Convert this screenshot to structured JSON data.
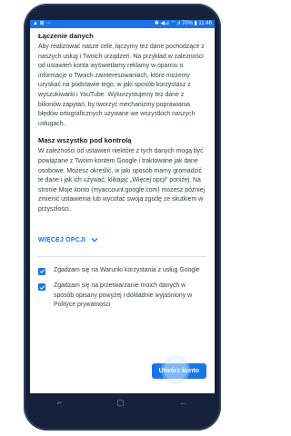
{
  "status_bar": {
    "left_icons": "▲ ⊠ ⋯",
    "right_text": "✱ ◀⊿ ⌔.ıl 70% ▮ 11:46"
  },
  "sections": [
    {
      "title": "Łączenie danych",
      "body": "Aby realizować nasze cele, łączymy też dane pochodzące z naszych usług i Twoich urządzeń. Na przykład w zależności od ustawień konta wyświetlamy reklamy w oparciu o informacje o Twoich zainteresowaniach, które możemy uzyskać na podstawie tego, w jaki sposób korzystasz z wyszukiwarki i YouTube. Wykorzystujemy też dane z bilionów zapytań, by tworzyć mechanizmy poprawiania błędów ortograficznych używane we wszystkich naszych usługach."
    },
    {
      "title": "Masz wszystko pod kontrolą",
      "body": "W zależności od ustawień niektóre z tych danych mogą być powiązane z Twoim kontem Google i traktowane jak dane osobowe. Możesz określić, w jaki sposób mamy gromadzić te dane i jak ich używać, klikając „Więcej opcji” poniżej. Na stronie Moje konto (myaccount.google.com) możesz później zmienić ustawienia lub wycofać swoją zgodę ze skutkiem w przyszłości."
    }
  ],
  "more_options": {
    "label": "WIĘCEJ OPCJI",
    "icon": "chevron-down-icon"
  },
  "checkboxes": [
    {
      "label": "Zgadzam się na Warunki korzystania z usług Google",
      "checked": true
    },
    {
      "label": "Zgadzam się na przetwarzanie moich danych w sposób opisany powyżej i dokładnie wyjaśniony w Polityce prywatności",
      "checked": true
    }
  ],
  "create_button": {
    "label": "Utwórz konto"
  },
  "nav_bar": {
    "recents": "⌐",
    "home": "▢",
    "back": "←"
  },
  "colors": {
    "accent": "#1a73e8",
    "phone_body": "#16223a"
  }
}
